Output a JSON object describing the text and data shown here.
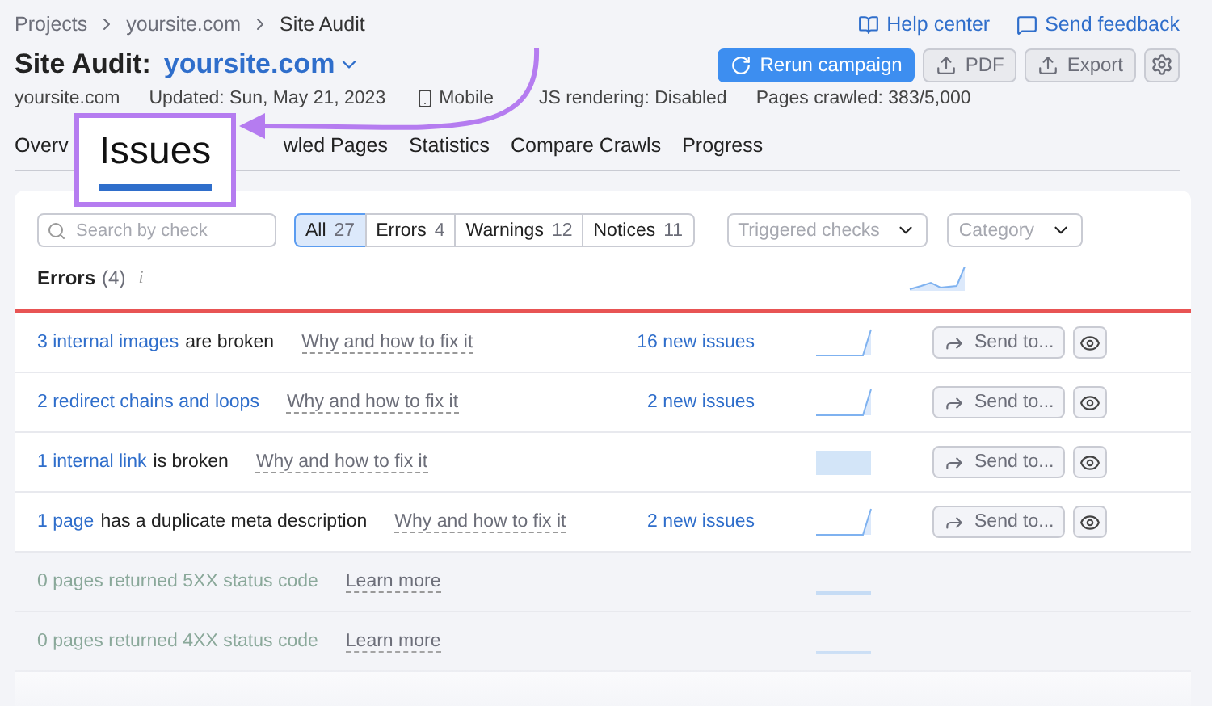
{
  "breadcrumbs": [
    "Projects",
    "yoursite.com",
    "Site Audit"
  ],
  "header_links": [
    "Help center",
    "Send feedback"
  ],
  "title": {
    "label": "Site Audit:",
    "project": "yoursite.com"
  },
  "actions": [
    {
      "kind": "primary",
      "label": "Rerun campaign"
    },
    {
      "kind": "pdf",
      "label": "PDF"
    },
    {
      "kind": "export",
      "label": "Export"
    },
    {
      "kind": "settings"
    }
  ],
  "meta": {
    "site": "yoursite.com",
    "updated": "Updated: Sun, May 21, 2023",
    "device": "Mobile",
    "js": "JS rendering: Disabled",
    "pages": "Pages crawled: 383/5,000"
  },
  "tabs": [
    {
      "label": "Overv",
      "selected": false
    },
    {
      "label": "wled Pages",
      "selected": false
    },
    {
      "label": "Statistics",
      "selected": false
    },
    {
      "label": "Compare Crawls",
      "selected": false
    },
    {
      "label": "Progress",
      "selected": false
    }
  ],
  "callout": {
    "label": "Issues"
  },
  "search": {
    "placeholder": "Search by check"
  },
  "filters": [
    {
      "label": "All",
      "count": "27",
      "selected": true
    },
    {
      "label": "Errors",
      "count": "4",
      "selected": false
    },
    {
      "label": "Warnings",
      "count": "12",
      "selected": false
    },
    {
      "label": "Notices",
      "count": "11",
      "selected": false
    }
  ],
  "dropdowns": [
    "Triggered checks",
    "Category"
  ],
  "section": {
    "title": "Errors",
    "count": "(4)",
    "info": "i"
  },
  "rows": [
    {
      "kind": "issue",
      "link": "3 internal images",
      "text": "are broken",
      "help": "Why and how to fix it",
      "new": "16 new issues",
      "sparkline": {
        "kind": "rise"
      },
      "send": "Send to..."
    },
    {
      "kind": "issue",
      "link": "2 redirect chains and loops",
      "help": "Why and how to fix it",
      "new": "2 new issues",
      "sparkline": {
        "kind": "rise"
      },
      "send": "Send to..."
    },
    {
      "kind": "issue",
      "link": "1 internal link",
      "text": "is broken",
      "help": "Why and how to fix it",
      "sparkline": {
        "kind": "block"
      },
      "send": "Send to..."
    },
    {
      "kind": "issue",
      "link": "1 page",
      "text": "has a duplicate meta description",
      "help": "Why and how to fix it",
      "new": "2 new issues",
      "sparkline": {
        "kind": "rise"
      },
      "send": "Send to..."
    },
    {
      "kind": "passed",
      "text": "0 pages returned 5XX status code",
      "help": "Learn more",
      "sparkline": {
        "kind": "flat"
      }
    },
    {
      "kind": "passed",
      "text": "0 pages returned 4XX status code",
      "help": "Learn more",
      "sparkline": {
        "kind": "flat"
      }
    }
  ]
}
